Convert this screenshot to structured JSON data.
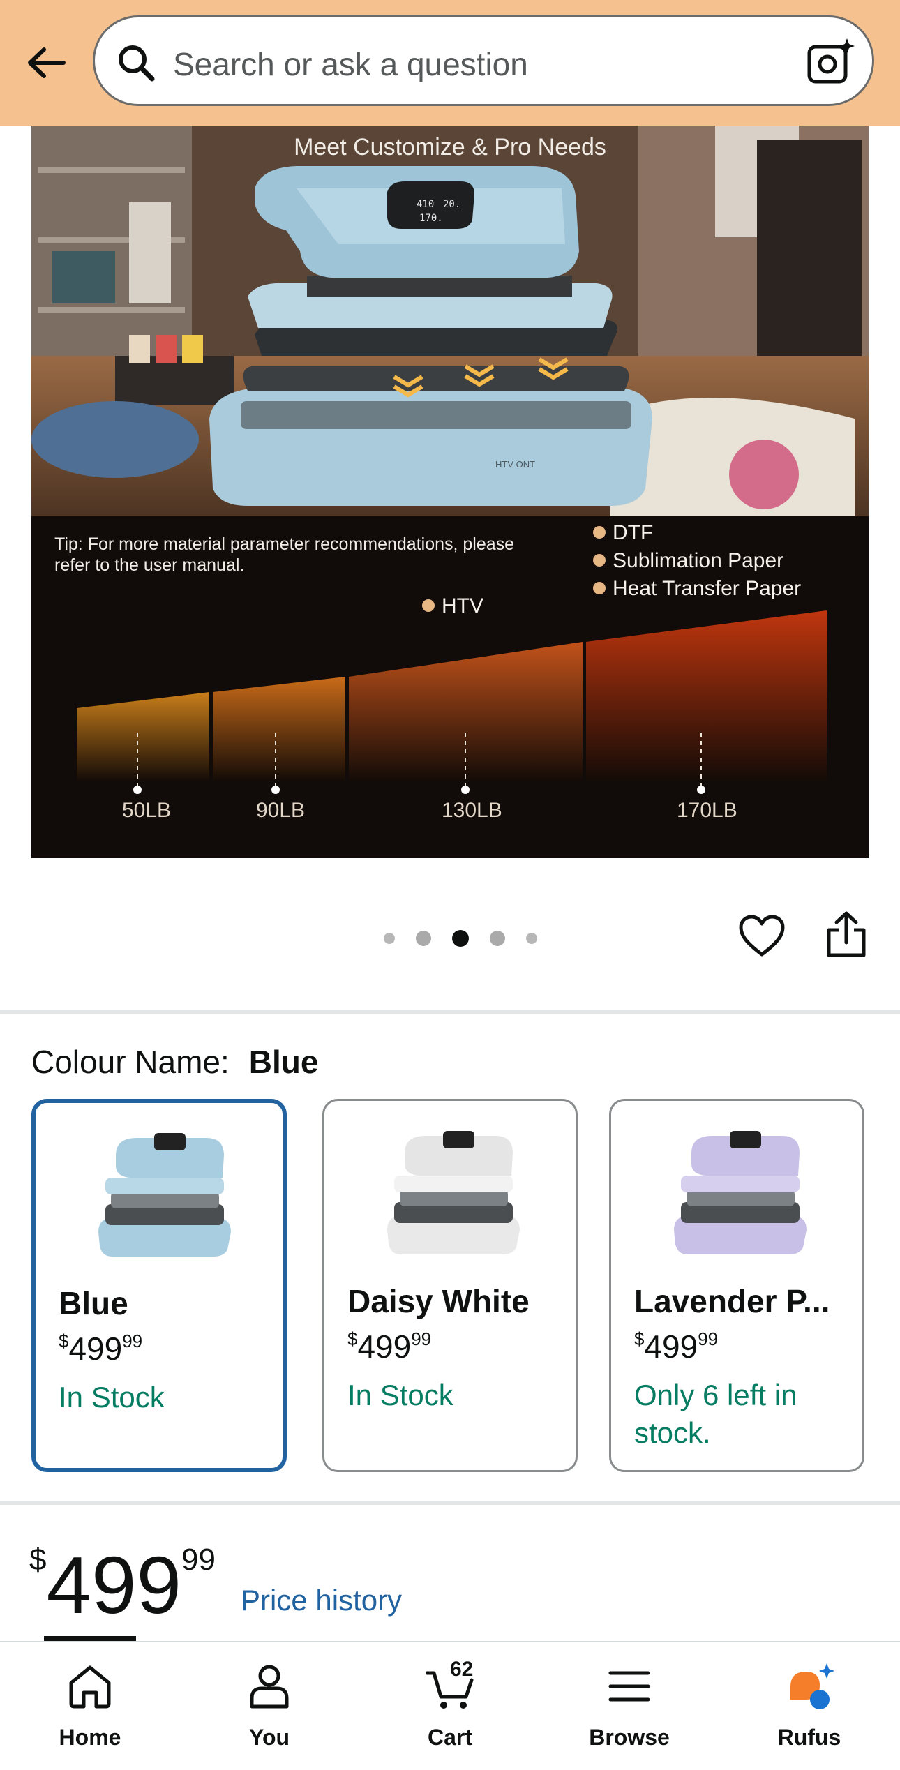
{
  "search": {
    "placeholder": "Search or ask a question"
  },
  "hero": {
    "title": "Meet Customize & Pro Needs",
    "tip": "Tip: For more material parameter recommendations, please refer to the user manual.",
    "materials": [
      "DTF",
      "Sublimation Paper",
      "Heat Transfer Paper",
      "HTV"
    ],
    "pressure_labels": [
      "50LB",
      "90LB",
      "130LB",
      "170LB"
    ],
    "device_screen": [
      "410° 20.",
      "170."
    ],
    "brand_mark": "HTV ® ONT",
    "gallery_index": 3,
    "gallery_count": 5
  },
  "colour": {
    "label": "Colour Name:",
    "value": "Blue",
    "options": [
      {
        "name": "Blue",
        "currency": "$",
        "price_whole": "499",
        "price_frac": "99",
        "stock": "In Stock",
        "color": "#a9cde0"
      },
      {
        "name": "Daisy White",
        "currency": "$",
        "price_whole": "499",
        "price_frac": "99",
        "stock": "In Stock",
        "color": "#e9e9ea"
      },
      {
        "name": "Lavender P...",
        "currency": "$",
        "price_whole": "499",
        "price_frac": "99",
        "stock": "Only 6 left in stock.",
        "color": "#c8c0e6"
      }
    ]
  },
  "price": {
    "currency": "$",
    "whole": "499",
    "fraction": "99",
    "history_link": "Price history"
  },
  "nav": {
    "items": [
      {
        "label": "Home"
      },
      {
        "label": "You"
      },
      {
        "label": "Cart",
        "badge": "62"
      },
      {
        "label": "Browse"
      },
      {
        "label": "Rufus"
      }
    ]
  },
  "colors": {
    "header_bg": "#f5c28f",
    "link": "#2162a1",
    "stock_green": "#067d62",
    "selected_border": "#2162a1"
  }
}
